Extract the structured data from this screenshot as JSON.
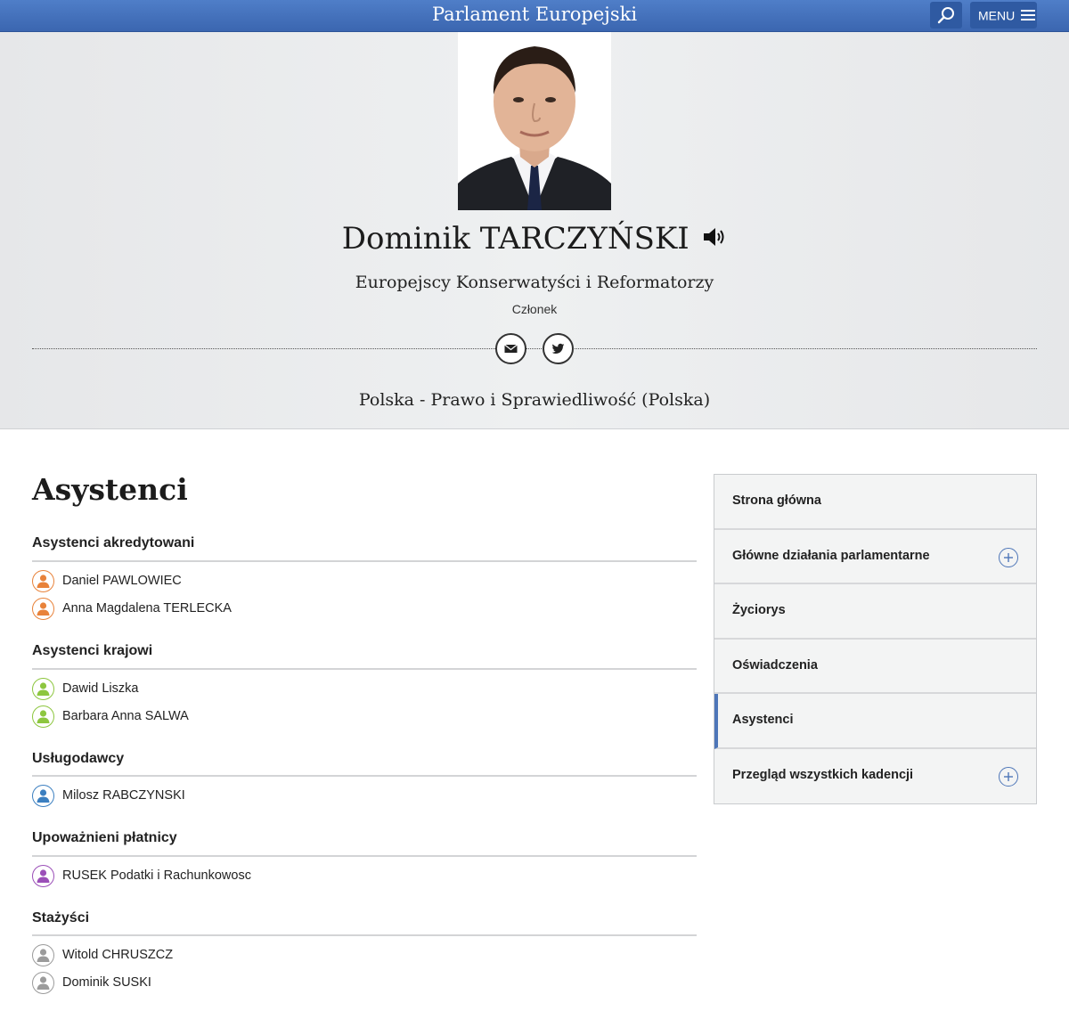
{
  "topbar": {
    "site_title": "Parlament Europejski",
    "menu_label": "MENU",
    "search_icon": "search-icon",
    "menu_icon": "hamburger-icon"
  },
  "profile": {
    "name": "Dominik TARCZYŃSKI",
    "political_group": "Europejscy Konserwatyści i Reformatorzy",
    "role": "Członek",
    "country_party": "Polska - Prawo i Sprawiedliwość (Polska)",
    "audio_icon": "speaker-icon",
    "contact_icons": [
      "email-icon",
      "twitter-icon"
    ]
  },
  "main": {
    "heading": "Asystenci",
    "sections": [
      {
        "title": "Asystenci akredytowani",
        "color": "#e8823a",
        "people": [
          "Daniel PAWLOWIEC",
          "Anna Magdalena TERLECKA"
        ]
      },
      {
        "title": "Asystenci krajowi",
        "color": "#8dc63f",
        "people": [
          "Dawid Liszka",
          "Barbara Anna SALWA"
        ]
      },
      {
        "title": "Usługodawcy",
        "color": "#3b7fc0",
        "people": [
          "Milosz RABCZYNSKI"
        ]
      },
      {
        "title": "Upoważnieni płatnicy",
        "color": "#9b4fb8",
        "people": [
          "RUSEK Podatki i Rachunkowosc"
        ]
      },
      {
        "title": "Stażyści",
        "color": "#9b9b9b",
        "people": [
          "Witold CHRUSZCZ",
          "Dominik SUSKI"
        ]
      }
    ]
  },
  "sidebar": {
    "items": [
      {
        "label": "Strona główna",
        "expandable": false,
        "active": false
      },
      {
        "label": "Główne działania parlamentarne",
        "expandable": true,
        "active": false
      },
      {
        "label": "Życiorys",
        "expandable": false,
        "active": false
      },
      {
        "label": "Oświadczenia",
        "expandable": false,
        "active": false
      },
      {
        "label": "Asystenci",
        "expandable": false,
        "active": true
      },
      {
        "label": "Przegląd wszystkich kadencji",
        "expandable": true,
        "active": false
      }
    ],
    "accent_color": "#4e76b8"
  }
}
